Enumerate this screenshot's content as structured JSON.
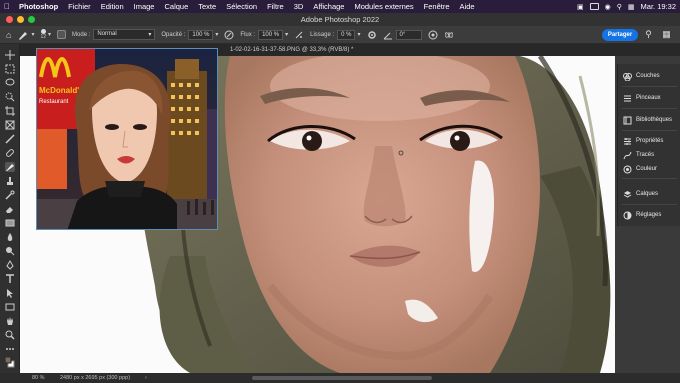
{
  "menubar": {
    "app_name": "Photoshop",
    "items": [
      "Fichier",
      "Edition",
      "Image",
      "Calque",
      "Texte",
      "Sélection",
      "Filtre",
      "3D",
      "Affichage",
      "Modules externes",
      "Fenêtre",
      "Aide"
    ],
    "clock": "Mar. 19:32"
  },
  "window": {
    "title": "Adobe Photoshop 2022"
  },
  "options": {
    "brush_size": "12",
    "mode_label": "Mode :",
    "mode_value": "Normal",
    "opacity_label": "Opacité :",
    "opacity_value": "100 %",
    "flux_label": "Flux :",
    "flux_value": "100 %",
    "smoothing_label": "Lissage :",
    "smoothing_value": "0 %",
    "angle_value": "0°",
    "share_label": "Partager"
  },
  "document": {
    "tab_label": "1-02-02-16-31-37-58.PNG @ 33,3% (RVB/8) *"
  },
  "panels": [
    {
      "label": "Couches",
      "icon": "channels-icon"
    },
    {
      "label": "Pinceaux",
      "icon": "brushes-icon"
    },
    {
      "label": "Bibliothèques",
      "icon": "libraries-icon"
    },
    {
      "label": "Propriétés",
      "icon": "properties-icon"
    },
    {
      "label": "Tracés",
      "icon": "paths-icon"
    },
    {
      "label": "Couleur",
      "icon": "color-icon"
    },
    {
      "label": "Calques",
      "icon": "layers-icon"
    },
    {
      "label": "Réglages",
      "icon": "adjustments-icon"
    }
  ],
  "statusbar": {
    "zoom": "80 %",
    "doc_size": "2480 px x 2695 px (300 ppp)"
  },
  "reference": {
    "sign_text_1": "McDonald's",
    "sign_text_2": "Restaurant"
  },
  "colors": {
    "accent": "#1473e6",
    "menubar_bg": "#2a1d3b",
    "panel_bg": "#323232"
  }
}
